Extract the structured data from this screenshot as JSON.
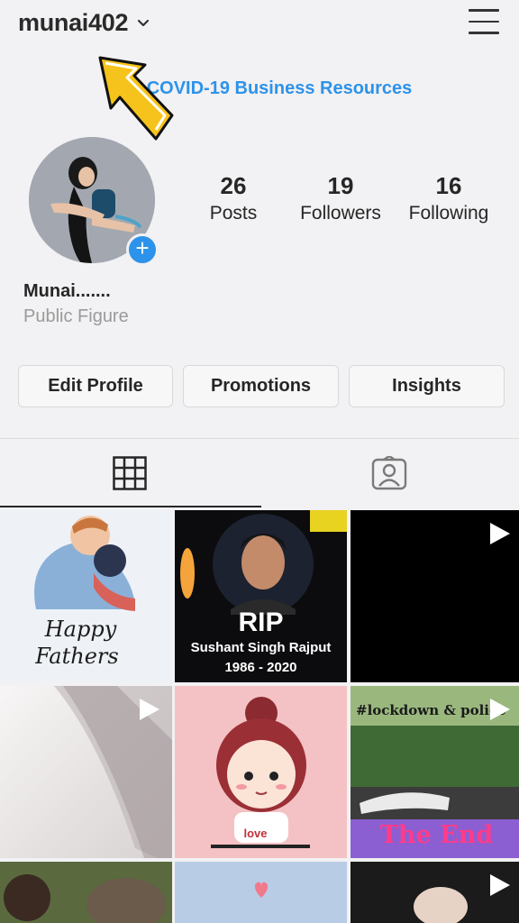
{
  "header": {
    "username": "munai402"
  },
  "business_link": "COVID-19 Business Resources",
  "profile": {
    "full_name": "Munai.......",
    "category": "Public Figure"
  },
  "stats": [
    {
      "value": "26",
      "label": "Posts"
    },
    {
      "value": "19",
      "label": "Followers"
    },
    {
      "value": "16",
      "label": "Following"
    }
  ],
  "buttons": {
    "edit_profile": "Edit Profile",
    "promotions": "Promotions",
    "insights": "Insights"
  },
  "tabs": {
    "active": "grid"
  },
  "posts": [
    {
      "caption_line1": "Happy",
      "caption_line2": "Fathers",
      "video": false
    },
    {
      "title": "RIP",
      "name": "Sushant Singh Rajput",
      "years": "1986 - 2020",
      "video": false
    },
    {
      "video": true
    },
    {
      "video": true
    },
    {
      "badge": "love",
      "video": false
    },
    {
      "hashtag": "#lockdown & police",
      "ending": "The End",
      "video": true
    },
    {
      "video": false
    },
    {
      "video": false
    },
    {
      "video": true
    }
  ],
  "colors": {
    "accent": "#2d93ea",
    "background": "#f2f1f3",
    "overlay_arrow": "#f6c31c"
  }
}
